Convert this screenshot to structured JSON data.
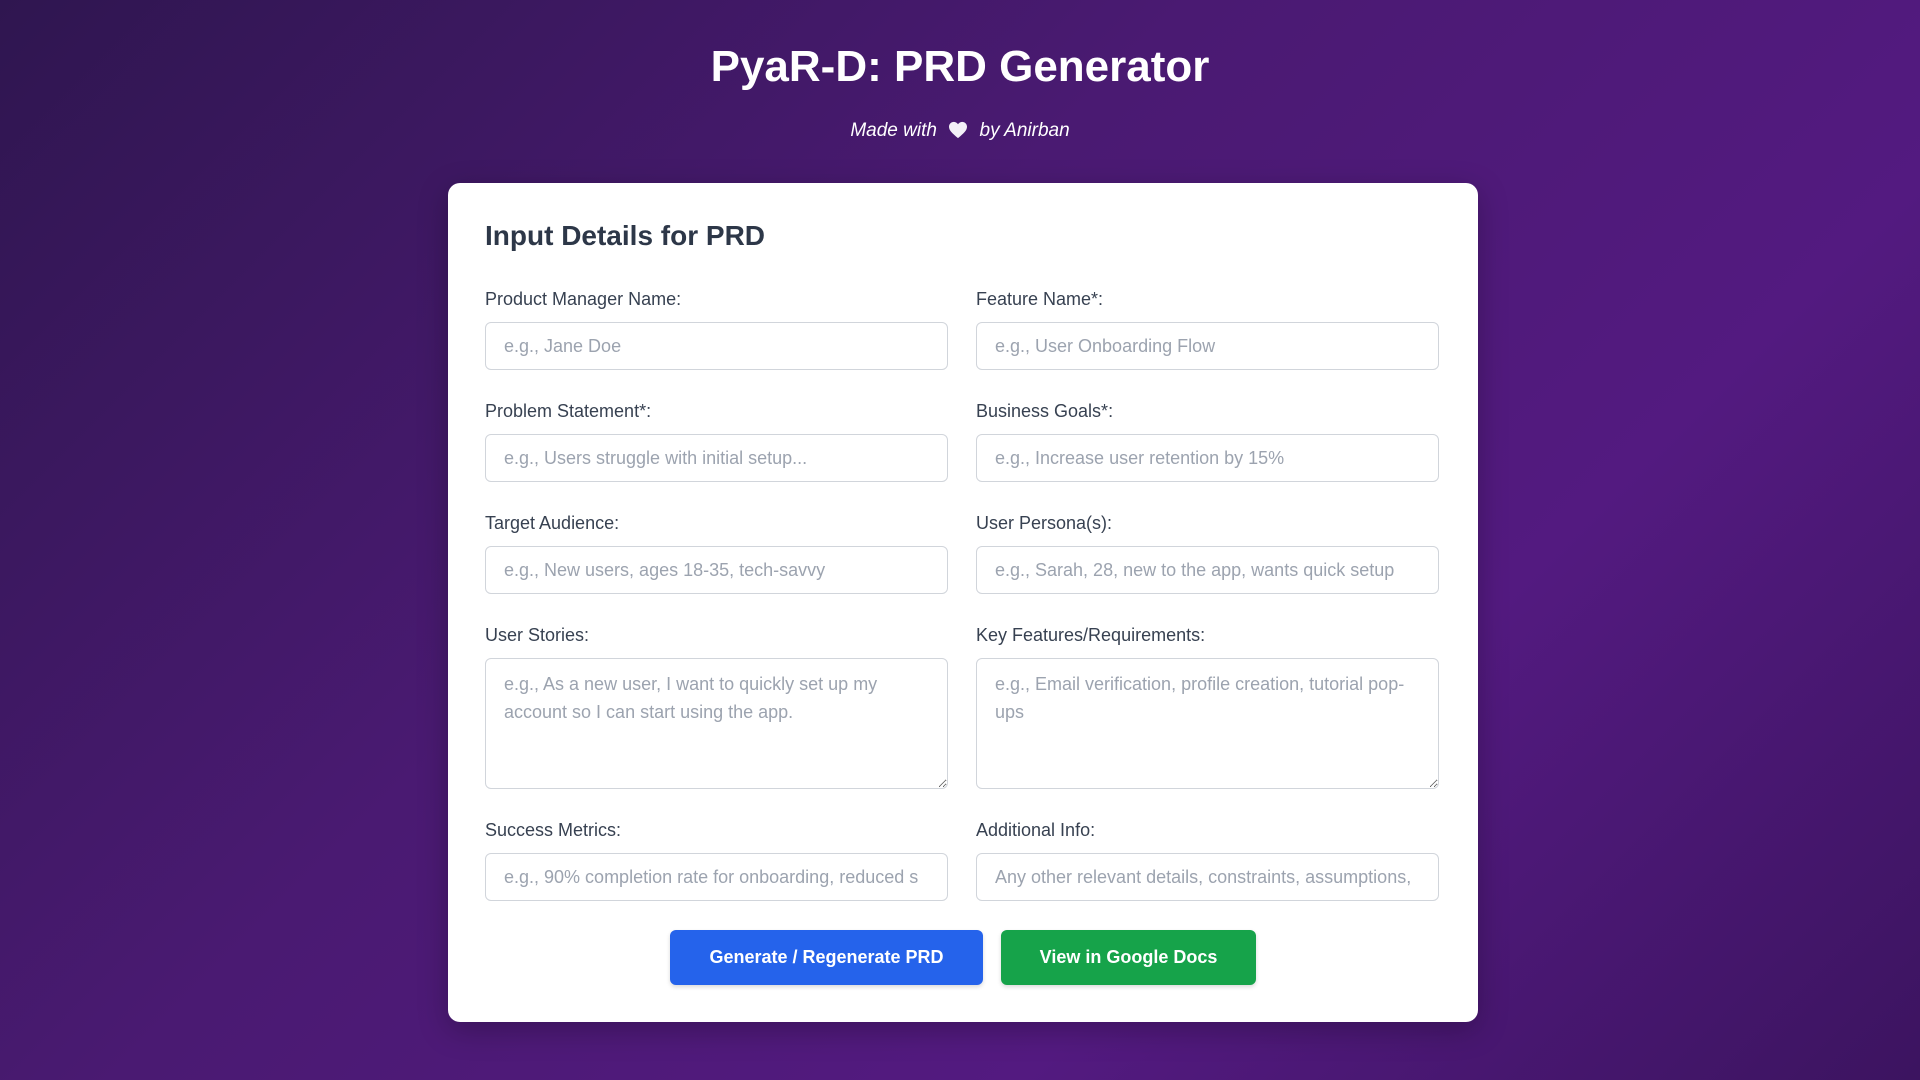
{
  "header": {
    "title": "PyaR-D: PRD Generator",
    "byline_prefix": "Made with",
    "byline_suffix": "by Anirban"
  },
  "form": {
    "title": "Input Details for PRD",
    "fields": {
      "pm_name": {
        "label": "Product Manager Name:",
        "placeholder": "e.g., Jane Doe",
        "value": ""
      },
      "feature_name": {
        "label": "Feature Name*:",
        "placeholder": "e.g., User Onboarding Flow",
        "value": ""
      },
      "problem_statement": {
        "label": "Problem Statement*:",
        "placeholder": "e.g., Users struggle with initial setup...",
        "value": ""
      },
      "business_goals": {
        "label": "Business Goals*:",
        "placeholder": "e.g., Increase user retention by 15%",
        "value": ""
      },
      "target_audience": {
        "label": "Target Audience:",
        "placeholder": "e.g., New users, ages 18-35, tech-savvy",
        "value": ""
      },
      "user_personas": {
        "label": "User Persona(s):",
        "placeholder": "e.g., Sarah, 28, new to the app, wants quick setup",
        "value": ""
      },
      "user_stories": {
        "label": "User Stories:",
        "placeholder": "e.g., As a new user, I want to quickly set up my account so I can start using the app.",
        "value": ""
      },
      "key_features": {
        "label": "Key Features/Requirements:",
        "placeholder": "e.g., Email verification, profile creation, tutorial pop-ups",
        "value": ""
      },
      "success_metrics": {
        "label": "Success Metrics:",
        "placeholder": "e.g., 90% completion rate for onboarding, reduced s",
        "value": ""
      },
      "additional_info": {
        "label": "Additional Info:",
        "placeholder": "Any other relevant details, constraints, assumptions,",
        "value": ""
      }
    },
    "buttons": {
      "generate": "Generate / Regenerate PRD",
      "docs": "View in Google Docs"
    }
  },
  "colors": {
    "primary_button": "#2563eb",
    "success_button": "#16a34a",
    "background_start": "#2f1650",
    "background_end": "#531a80"
  },
  "icons": {
    "heart": "heart-icon"
  }
}
